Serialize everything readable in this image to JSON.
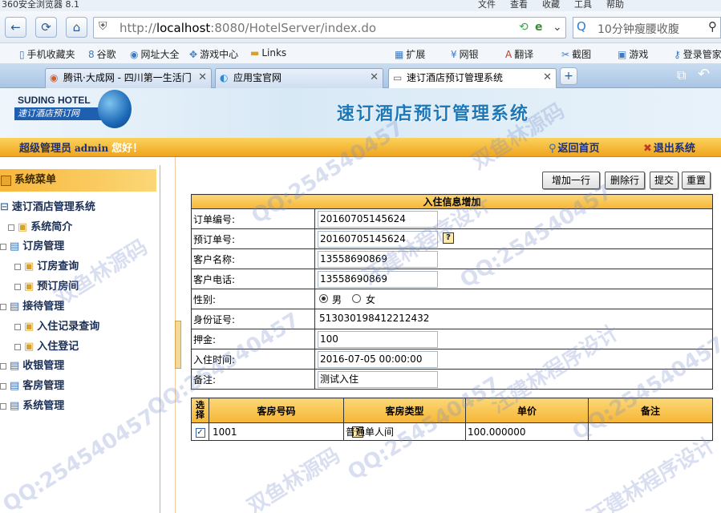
{
  "browser": {
    "title": "360安全浏览器 8.1",
    "menus": [
      "文件",
      "查看",
      "收藏",
      "工具",
      "帮助"
    ],
    "url_prefix": "http://",
    "url_host": "localhost",
    "url_rest": ":8080/HotelServer/index.do",
    "search_text": "10分钟瘦腰收腹",
    "favorites": [
      "手机收藏夹",
      "谷歌",
      "网址大全",
      "游戏中心",
      "Links"
    ],
    "right_tools": [
      "扩展",
      "网银",
      "翻译",
      "截图",
      "游戏",
      "登录管家"
    ],
    "tabs": [
      {
        "label": "腾讯·大成网 - 四川第一生活门"
      },
      {
        "label": "应用宝官网"
      },
      {
        "label": "速订酒店预订管理系统"
      }
    ]
  },
  "header": {
    "logo_en": "SUDING HOTEL",
    "logo_cn": "速订酒店预订网",
    "system_title": "速订酒店预订管理系统"
  },
  "userbar": {
    "role": "超级管理员",
    "username": "admin",
    "greeting": "您好！",
    "home_link": "返回首页",
    "logout_link": "退出系统"
  },
  "sidebar": {
    "header": "系统菜单",
    "root": "速订酒店管理系统",
    "items": [
      {
        "label": "系统简介"
      },
      {
        "label": "订房管理"
      },
      {
        "label": "订房查询"
      },
      {
        "label": "预订房间"
      },
      {
        "label": "接待管理"
      },
      {
        "label": "入住记录查询"
      },
      {
        "label": "入住登记"
      },
      {
        "label": "收银管理"
      },
      {
        "label": "客房管理"
      },
      {
        "label": "系统管理"
      }
    ]
  },
  "toolbar": {
    "add_row": "增加一行",
    "delete_row": "删除行",
    "submit": "提交",
    "reset": "重置"
  },
  "form": {
    "title": "入住信息增加",
    "fields": {
      "order_no": {
        "label": "订单编号:",
        "value": "20160705145624"
      },
      "booking_no": {
        "label": "预订单号:",
        "value": "20160705145624"
      },
      "customer_name": {
        "label": "客户名称:",
        "value": "13558690869"
      },
      "customer_phone": {
        "label": "客户电话:",
        "value": "13558690869"
      },
      "gender": {
        "label": "性别:",
        "options": [
          "男",
          "女"
        ],
        "selected": "男"
      },
      "id_card": {
        "label": "身份证号:",
        "value": "513030198412212432"
      },
      "deposit": {
        "label": "押金:",
        "value": "100"
      },
      "checkin_time": {
        "label": "入住时间:",
        "value": "2016-07-05 00:00:00"
      },
      "remark": {
        "label": "备注:",
        "value": "测试入住"
      }
    },
    "help_glyph": "?"
  },
  "rooms": {
    "headers": [
      "选择",
      "客房号码",
      "客房类型",
      "单价",
      "备注"
    ],
    "rows": [
      {
        "checked": true,
        "room_no": "1001",
        "room_type": "普通单人间",
        "price": "100.000000",
        "remark": ""
      }
    ]
  },
  "watermarks": [
    "QQ:254540457",
    "双鱼林源码",
    "汪建林程序设计"
  ]
}
